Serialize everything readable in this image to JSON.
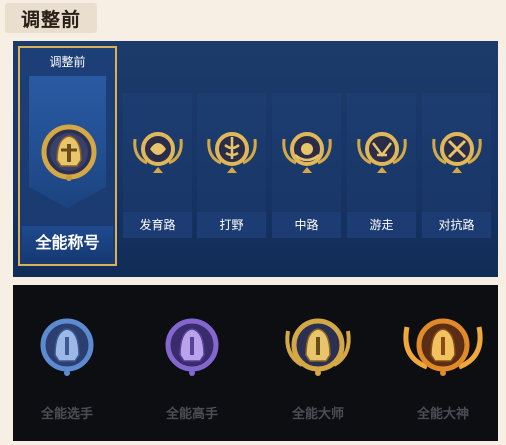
{
  "header": {
    "title": "调整前"
  },
  "selected_card": {
    "top_label": "调整前",
    "bottom_label": "全能称号"
  },
  "lanes": [
    {
      "label": "发育路",
      "icon": "bow-emblem-icon"
    },
    {
      "label": "打野",
      "icon": "leaf-emblem-icon"
    },
    {
      "label": "中路",
      "icon": "orb-emblem-icon"
    },
    {
      "label": "游走",
      "icon": "wings-emblem-icon"
    },
    {
      "label": "对抗路",
      "icon": "crossed-swords-emblem-icon"
    }
  ],
  "tiers": [
    {
      "label": "全能选手",
      "color": "#4f7fc8"
    },
    {
      "label": "全能高手",
      "color": "#7b5cc6"
    },
    {
      "label": "全能大师",
      "color": "#d4a845"
    },
    {
      "label": "全能大神",
      "color": "#e08a2a"
    }
  ],
  "colors": {
    "gold": "#d8b15a",
    "panel_blue": "#173566",
    "dark_bg": "#0d0e12"
  }
}
